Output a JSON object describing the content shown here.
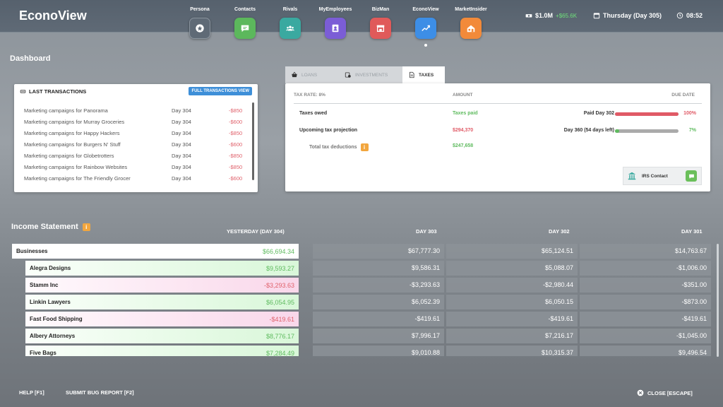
{
  "brand": "EconoView",
  "apps": [
    {
      "label": "Persona",
      "icon": "persona-star-icon",
      "color": "#5f6a76"
    },
    {
      "label": "Contacts",
      "icon": "contacts-chat-icon",
      "color": "#5cb85c"
    },
    {
      "label": "Rivals",
      "icon": "rivals-people-icon",
      "color": "#3aa9a0"
    },
    {
      "label": "MyEmployees",
      "icon": "employees-badge-icon",
      "color": "#7b5dd6"
    },
    {
      "label": "BizMan",
      "icon": "bizman-store-icon",
      "color": "#e05a5a"
    },
    {
      "label": "EconoView",
      "icon": "econoview-chart-icon",
      "color": "#3d8ee6"
    },
    {
      "label": "MarketInsider",
      "icon": "marketinsider-home-icon",
      "color": "#f28a3a"
    }
  ],
  "status": {
    "money": "$1.0M",
    "money_change": "+$65.6K",
    "day": "Thursday (Day 305)",
    "time": "08:52"
  },
  "dashboard_title": "Dashboard",
  "last_transactions": {
    "title": "LAST TRANSACTIONS",
    "button": "FULL TRANSACTIONS VIEW",
    "rows": [
      {
        "desc": "Marketing campaigns for Panorama",
        "day": "Day 304",
        "amount": "-$850"
      },
      {
        "desc": "Marketing campaigns for Murray Groceries",
        "day": "Day 304",
        "amount": "-$600"
      },
      {
        "desc": "Marketing campaigns for Happy Hackers",
        "day": "Day 304",
        "amount": "-$850"
      },
      {
        "desc": "Marketing campaigns for Burgers N' Stuff",
        "day": "Day 304",
        "amount": "-$600"
      },
      {
        "desc": "Marketing campaigns for Globetrotters",
        "day": "Day 304",
        "amount": "-$850"
      },
      {
        "desc": "Marketing campaigns for Rainbow Websites",
        "day": "Day 304",
        "amount": "-$850"
      },
      {
        "desc": "Marketing campaigns for The Friendly Grocer",
        "day": "Day 304",
        "amount": "-$600"
      }
    ]
  },
  "tabs": [
    {
      "label": "LOANS",
      "icon": "basket-icon",
      "active": false
    },
    {
      "label": "INVESTMENTS",
      "icon": "investments-icon",
      "active": false
    },
    {
      "label": "TAXES",
      "icon": "document-icon",
      "active": true
    }
  ],
  "taxes": {
    "col_rate": "TAX RATE: 8%",
    "col_amount": "AMOUNT",
    "col_due": "DUE DATE",
    "owed_label": "Taxes owed",
    "owed_amount": "Taxes paid",
    "owed_due": "Paid Day 302",
    "owed_pct": "100%",
    "owed_progress": 1.0,
    "proj_label": "Upcoming tax projection",
    "proj_amount": "$294,370",
    "proj_due": "Day 360 (54 days left)",
    "proj_pct": "7%",
    "proj_progress": 0.07,
    "deduct_label": "Total tax deductions",
    "deduct_amount": "$247,658",
    "irs_label": "IRS Contact"
  },
  "income": {
    "title": "Income Statement",
    "columns": [
      "YESTERDAY (DAY 304)",
      "DAY 303",
      "DAY 302",
      "DAY 301"
    ],
    "rows": [
      {
        "name": "Businesses",
        "type": "total",
        "values": [
          "$66,694.34",
          "$67,777.30",
          "$65,124.51",
          "$14,763.67"
        ]
      },
      {
        "name": "Alegra Designs",
        "type": "pos",
        "values": [
          "$9,593.27",
          "$9,586.31",
          "$5,088.07",
          "-$1,006.00"
        ]
      },
      {
        "name": "Stamm Inc",
        "type": "neg",
        "values": [
          "-$3,293.63",
          "-$3,293.63",
          "-$2,980.44",
          "-$351.00"
        ]
      },
      {
        "name": "Linkin Lawyers",
        "type": "pos",
        "values": [
          "$6,054.95",
          "$6,052.39",
          "$6,050.15",
          "-$873.00"
        ]
      },
      {
        "name": "Fast Food Shipping",
        "type": "neg",
        "values": [
          "-$419.61",
          "-$419.61",
          "-$419.61",
          "-$419.61"
        ]
      },
      {
        "name": "Albery Attorneys",
        "type": "pos",
        "values": [
          "$8,776.17",
          "$7,996.17",
          "$7,216.17",
          "-$1,045.00"
        ]
      },
      {
        "name": "Five Bags",
        "type": "pos",
        "values": [
          "$7,284.49",
          "$9,010.88",
          "$10,315.37",
          "$9,496.54"
        ]
      }
    ]
  },
  "footer": {
    "help": "HELP [F1]",
    "bug": "SUBMIT BUG REPORT [F2]",
    "close": "CLOSE [ESCAPE]"
  }
}
